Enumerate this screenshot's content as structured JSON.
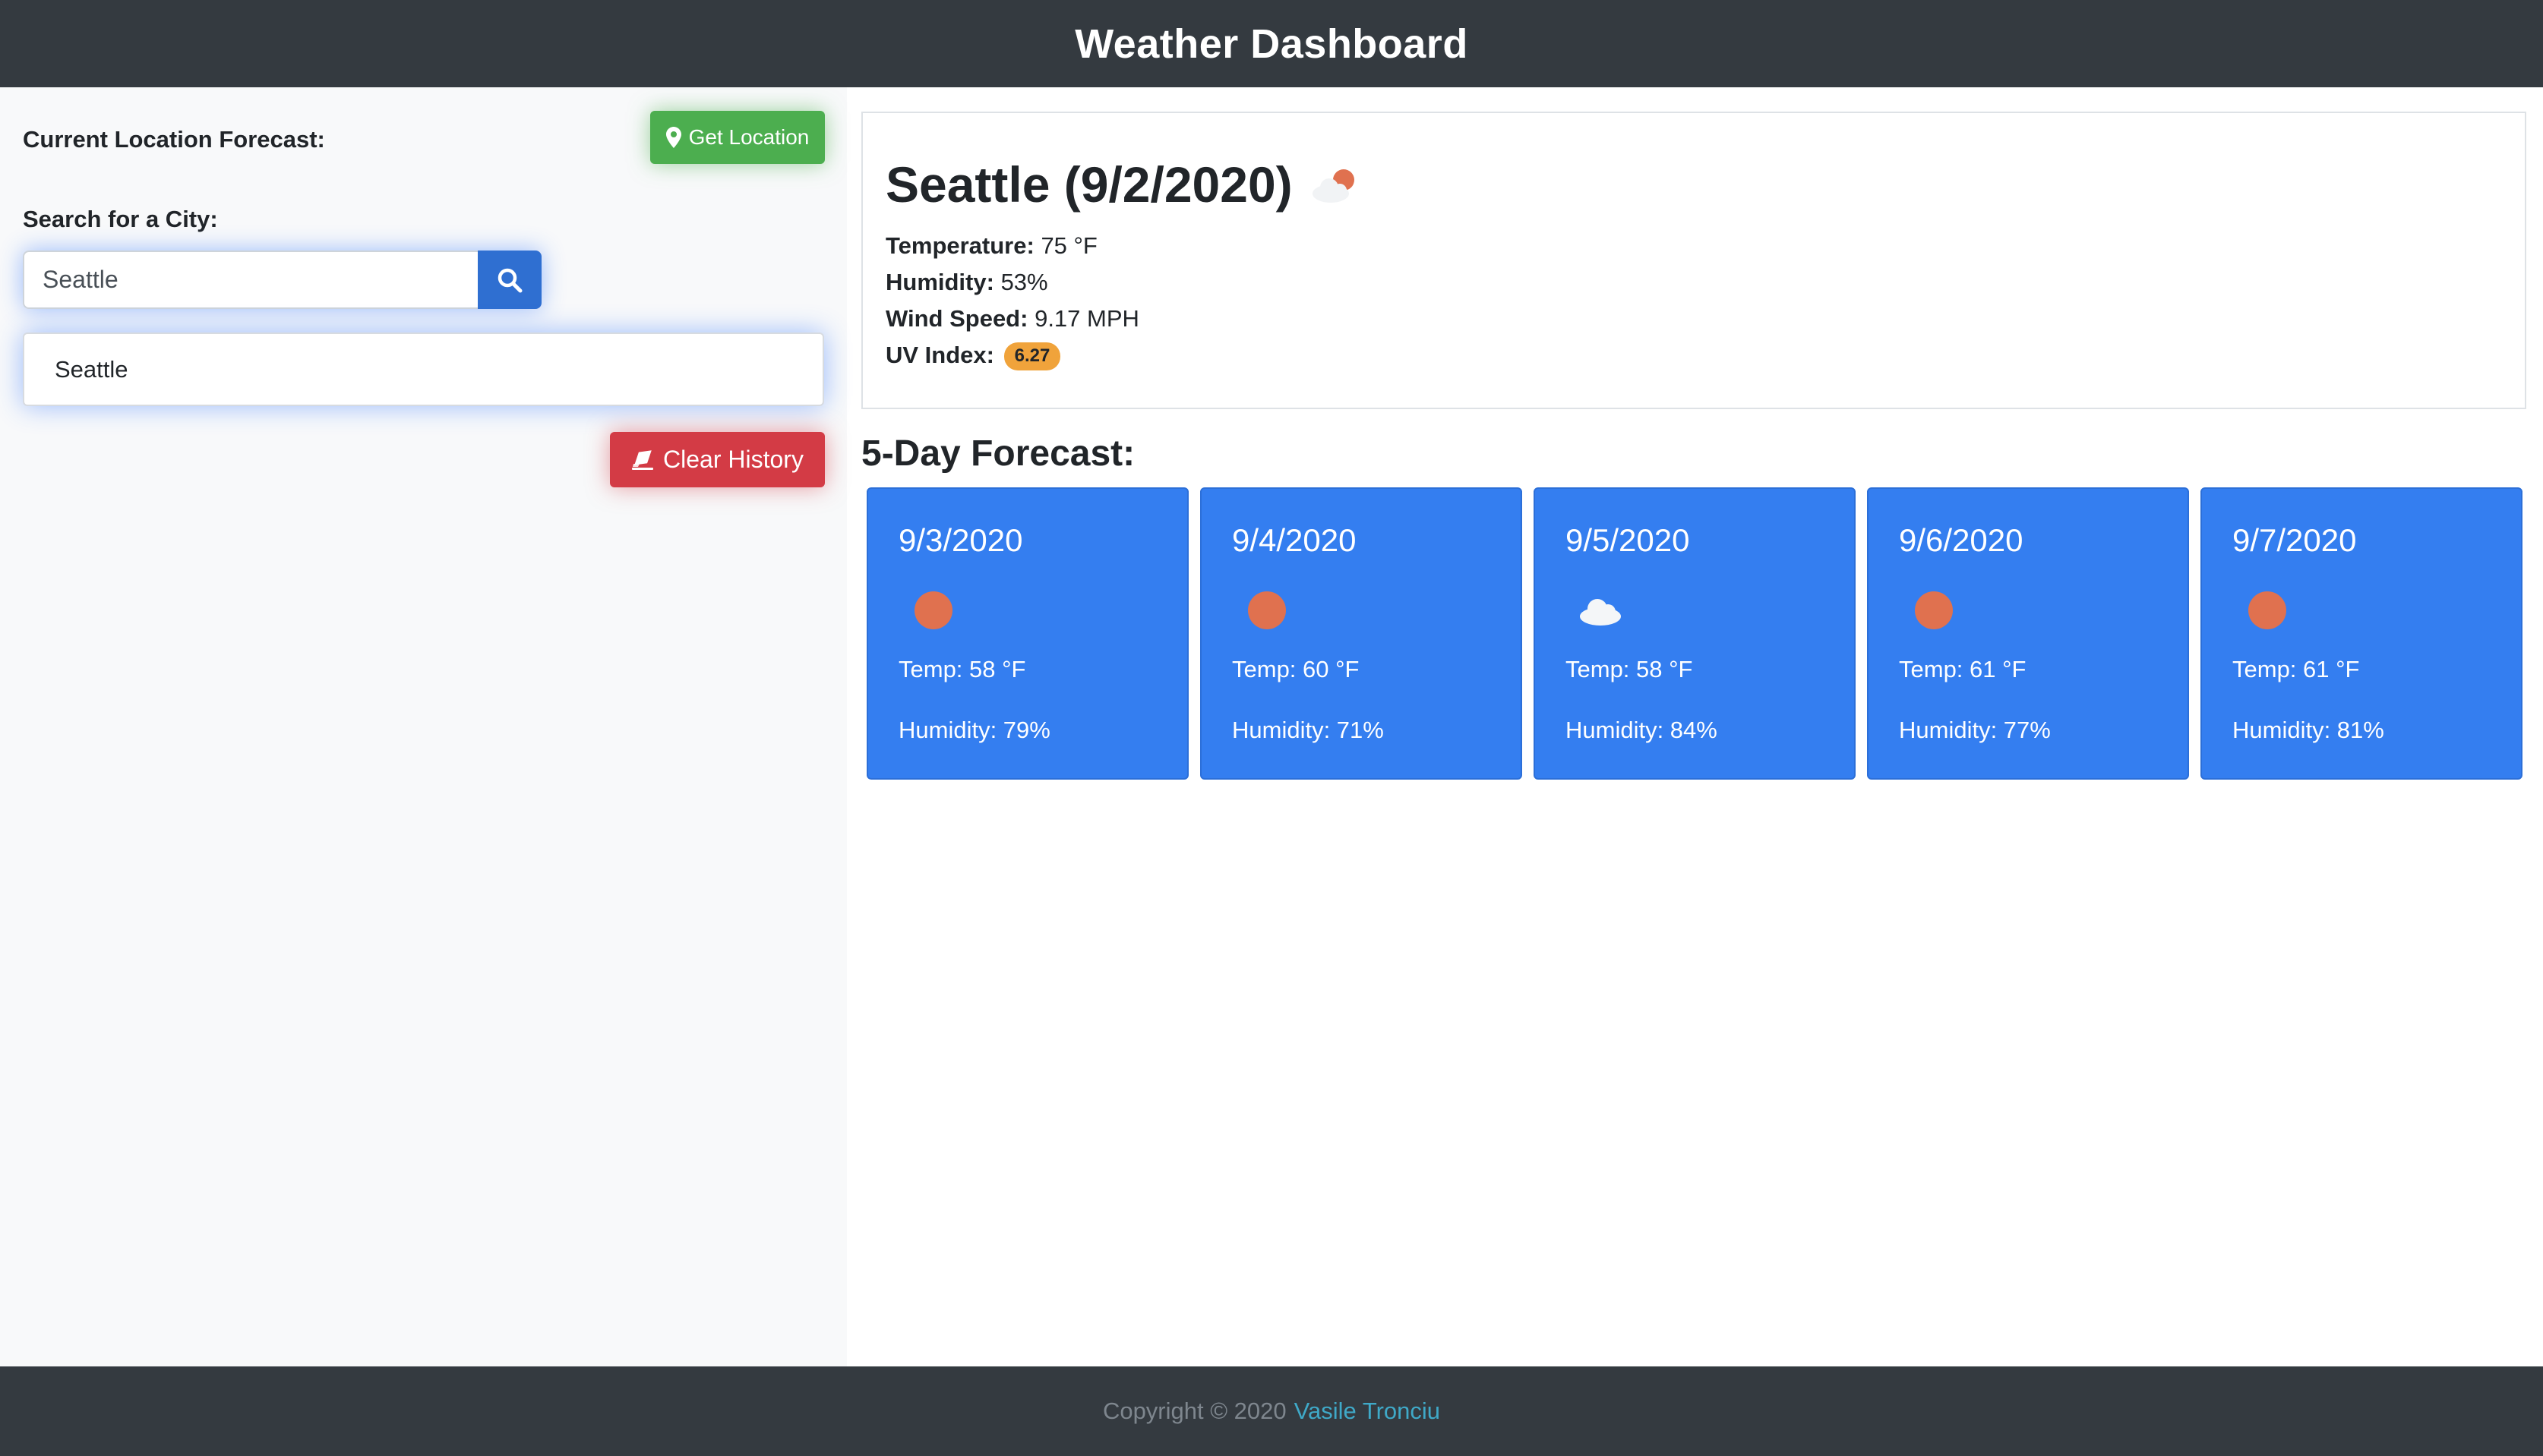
{
  "header": {
    "title": "Weather Dashboard"
  },
  "sidebar": {
    "current_location_label": "Current Location Forecast:",
    "get_location_label": "Get Location",
    "search_label": "Search for a City:",
    "search_value": "Seattle",
    "search_icon": "search-icon",
    "history": [
      {
        "label": "Seattle"
      }
    ],
    "clear_history_label": "Clear History",
    "colors": {
      "location_button": "#4cae4f",
      "search_button": "#2f6fd1",
      "clear_button": "#d33b45"
    }
  },
  "current": {
    "title": "Seattle (9/2/2020)",
    "icon": "partly-cloudy-icon",
    "temperature_label": "Temperature:",
    "temperature_value": "75 °F",
    "humidity_label": "Humidity:",
    "humidity_value": "53%",
    "wind_label": "Wind Speed:",
    "wind_value": "9.17 MPH",
    "uv_label": "UV Index:",
    "uv_value": "6.27",
    "uv_color": "#f0a33b"
  },
  "forecast": {
    "title": "5-Day Forecast:",
    "card_color": "#347ef0",
    "days": [
      {
        "date": "9/3/2020",
        "icon": "sun-icon",
        "temp": "Temp: 58 °F",
        "humidity": "Humidity: 79%"
      },
      {
        "date": "9/4/2020",
        "icon": "sun-icon",
        "temp": "Temp: 60 °F",
        "humidity": "Humidity: 71%"
      },
      {
        "date": "9/5/2020",
        "icon": "cloud-icon",
        "temp": "Temp: 58 °F",
        "humidity": "Humidity: 84%"
      },
      {
        "date": "9/6/2020",
        "icon": "sun-icon",
        "temp": "Temp: 61 °F",
        "humidity": "Humidity: 77%"
      },
      {
        "date": "9/7/2020",
        "icon": "sun-icon",
        "temp": "Temp: 61 °F",
        "humidity": "Humidity: 81%"
      }
    ]
  },
  "footer": {
    "copyright": "Copyright © 2020",
    "author": "Vasile Tronciu"
  }
}
